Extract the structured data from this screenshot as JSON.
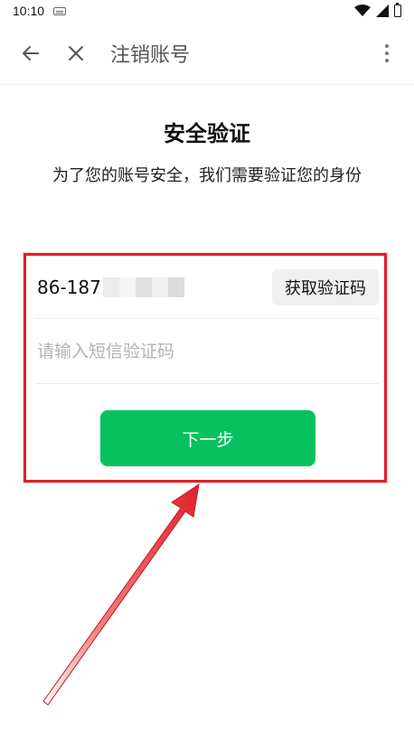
{
  "status_bar": {
    "time": "10:10"
  },
  "title_bar": {
    "title": "注销账号",
    "icons": [
      "back-arrow-icon",
      "close-icon",
      "more-vertical-icon"
    ]
  },
  "main": {
    "heading": "安全验证",
    "subtitle": "为了您的账号安全，我们需要验证您的身份"
  },
  "form": {
    "phone_value": "86-187",
    "get_code_label": "获取验证码",
    "code_placeholder": "请输入短信验证码",
    "code_value": "",
    "next_label": "下一步"
  },
  "colors": {
    "primary_green": "#07c160",
    "highlight_red": "#e0212b"
  }
}
